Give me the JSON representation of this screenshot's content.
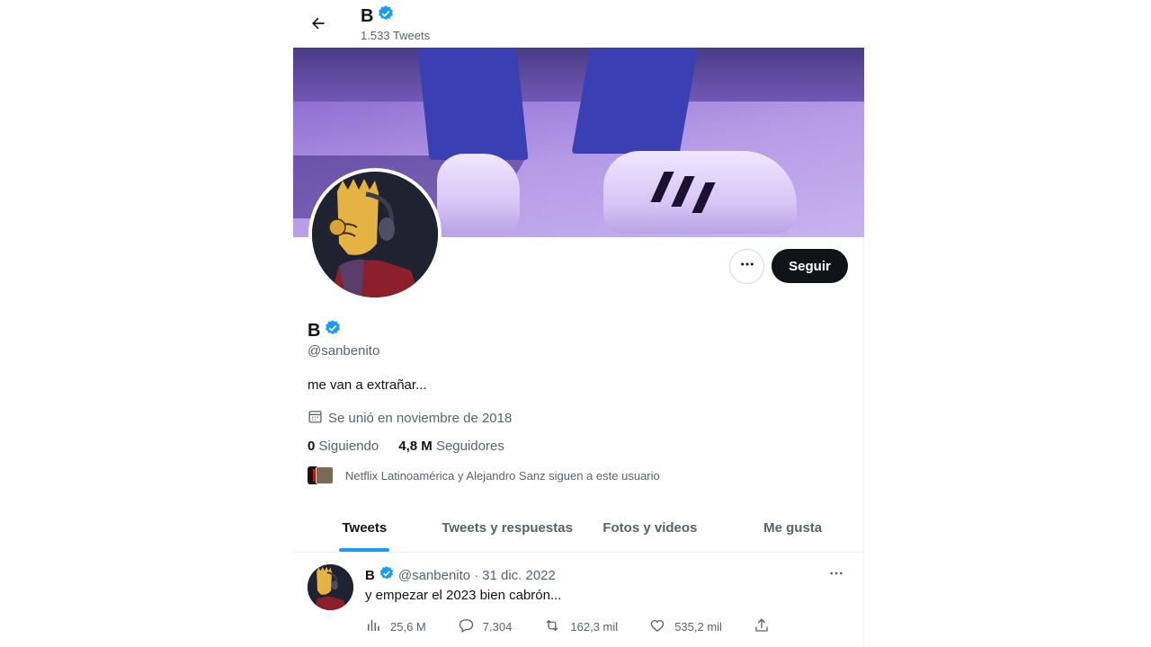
{
  "header": {
    "name": "B",
    "tweet_count": "1.533 Tweets"
  },
  "profile": {
    "name": "B",
    "handle": "@sanbenito",
    "bio": "me van a extrañar...",
    "joined": "Se unió en noviembre de 2018",
    "following_count": "0",
    "following_label": "Siguiendo",
    "followers_count": "4,8 M",
    "followers_label": "Seguidores",
    "mutual_text": "Netflix Latinoamérica y Alejandro Sanz siguen a este usuario",
    "follow_button": "Seguir"
  },
  "tabs": [
    "Tweets",
    "Tweets y respuestas",
    "Fotos y videos",
    "Me gusta"
  ],
  "active_tab": "Tweets",
  "tweet": {
    "name": "B",
    "handle": "@sanbenito",
    "separator": "·",
    "date": "31 dic. 2022",
    "text": "y empezar el 2023 bien cabrón...",
    "views": "25,6 M",
    "replies": "7.304",
    "retweets": "162,3 mil",
    "likes": "535,2 mil"
  },
  "colors": {
    "accent": "#1d9bf0",
    "text": "#0f1419",
    "secondary": "#536471",
    "button_dark": "#0f1419"
  },
  "icons": [
    "back-arrow-icon",
    "verified-badge-icon",
    "more-icon",
    "calendar-icon",
    "views-icon",
    "reply-icon",
    "retweet-icon",
    "like-icon",
    "share-icon"
  ]
}
